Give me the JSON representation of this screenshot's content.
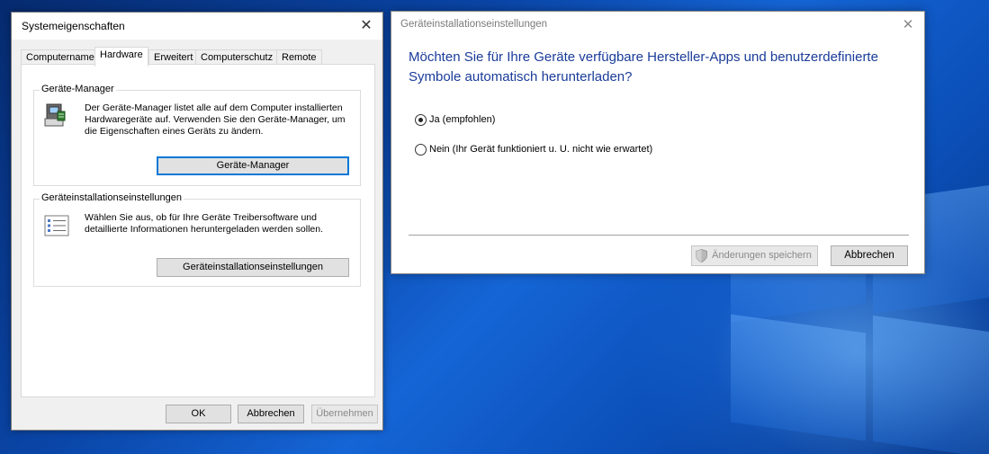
{
  "sys_window": {
    "title": "Systemeigenschaften",
    "tabs": [
      "Computername",
      "Hardware",
      "Erweitert",
      "Computerschutz",
      "Remote"
    ],
    "active_tab": "Hardware",
    "device_manager": {
      "legend": "Geräte-Manager",
      "text_lines": [
        "Der Geräte-Manager listet alle auf dem Computer installierten",
        "Hardwaregeräte auf. Verwenden Sie den Geräte-Manager, um",
        "die Eigenschaften eines Geräts zu ändern."
      ],
      "button": "Geräte-Manager"
    },
    "device_install": {
      "legend": "Geräteinstallationseinstellungen",
      "text_lines": [
        "Wählen Sie aus, ob für Ihre Geräte Treibersoftware und",
        "detaillierte Informationen heruntergeladen werden sollen."
      ],
      "button": "Geräteinstallationseinstellungen"
    },
    "footer": {
      "ok": "OK",
      "cancel": "Abbrechen",
      "apply": "Übernehmen"
    }
  },
  "dev_dialog": {
    "title": "Geräteinstallationseinstellungen",
    "heading_lines": [
      "Möchten Sie für Ihre Geräte verfügbare Hersteller-Apps und benutzerdefinierte",
      "Symbole automatisch herunterladen?"
    ],
    "options": [
      {
        "label": "Ja (empfohlen)",
        "checked": true
      },
      {
        "label": "Nein (Ihr Gerät funktioniert u. U. nicht wie erwartet)",
        "checked": false
      }
    ],
    "save_button": "Änderungen speichern",
    "cancel_button": "Abbrechen"
  },
  "icons": {
    "close": "close-icon",
    "device_manager": "device-manager-icon",
    "checklist": "checklist-icon",
    "shield": "uac-shield-icon"
  },
  "colors": {
    "heading_blue": "#1a3b9a",
    "focus_blue": "#0078d7",
    "desktop_blue": "#0a46a8"
  }
}
